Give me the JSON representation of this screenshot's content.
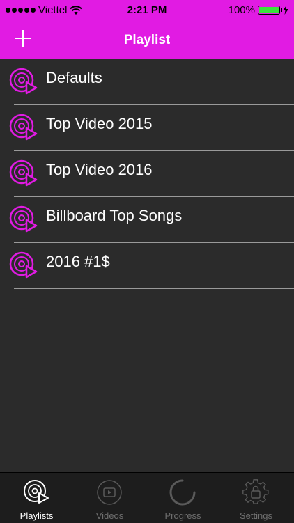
{
  "status_bar": {
    "carrier": "Viettel",
    "time": "2:21 PM",
    "battery": "100%"
  },
  "nav": {
    "title": "Playlist"
  },
  "playlists": [
    {
      "label": "Defaults"
    },
    {
      "label": "Top Video 2015"
    },
    {
      "label": "Top Video 2016"
    },
    {
      "label": "Billboard Top Songs"
    },
    {
      "label": "2016 #1$"
    }
  ],
  "tabs": [
    {
      "label": "Playlists",
      "icon": "playlist-disc-icon",
      "active": true
    },
    {
      "label": "Videos",
      "icon": "video-play-icon",
      "active": false
    },
    {
      "label": "Progress",
      "icon": "progress-spinner-icon",
      "active": false
    },
    {
      "label": "Settings",
      "icon": "settings-gear-icon",
      "active": false
    }
  ],
  "colors": {
    "accent": "#e11be3",
    "background": "#2b2b2b",
    "tabbar": "#1d1d1d",
    "separator": "#9a9a9a"
  }
}
